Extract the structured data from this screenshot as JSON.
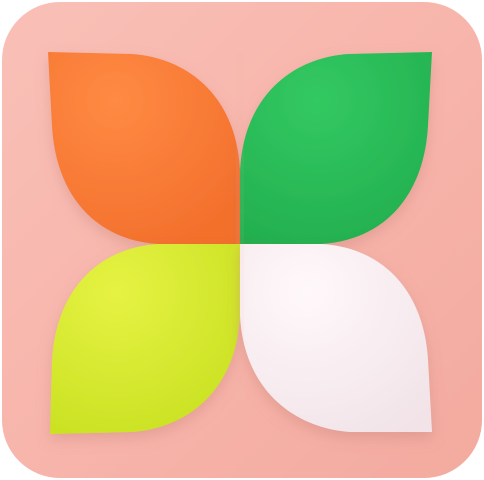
{
  "app_icon": {
    "icon": "four-petal-flower-icon",
    "colors": {
      "background": "#f7b4aa",
      "background_edge": "#f2a79d",
      "petal_top_left": "#ff7a35",
      "petal_top_right": "#2bbd57",
      "petal_bottom_left": "#d6ea2a",
      "petal_bottom_right": "#f8eef1"
    }
  }
}
